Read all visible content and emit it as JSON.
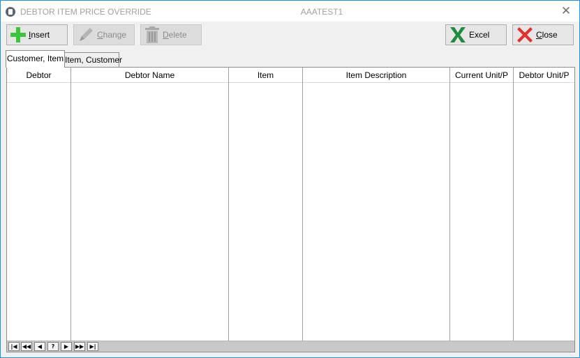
{
  "window": {
    "title": "DEBTOR ITEM PRICE OVERRIDE",
    "subtitle": "AAATEST1",
    "close_glyph": "✕"
  },
  "toolbar": {
    "insert": {
      "prefix": "",
      "accel": "I",
      "rest": "nsert",
      "icon": "plus-icon",
      "color": "#3cc43c"
    },
    "change": {
      "prefix": "",
      "accel": "C",
      "rest": "hange",
      "icon": "pencil-icon"
    },
    "delete": {
      "prefix": "",
      "accel": "D",
      "rest": "elete",
      "icon": "trash-icon"
    },
    "excel": {
      "label": "Excel",
      "icon": "excel-icon",
      "color": "#1e8c3c"
    },
    "close": {
      "prefix": "",
      "accel": "C",
      "rest": "lose",
      "icon": "red-x-icon",
      "color": "#e03030"
    }
  },
  "tabs": [
    {
      "label": "Customer, Item",
      "active": true
    },
    {
      "label": "Item, Customer",
      "active": false
    }
  ],
  "grid": {
    "columns": [
      "Debtor",
      "Debtor Name",
      "Item",
      "Item Description",
      "Current Unit/P",
      "Debtor Unit/P"
    ],
    "rows": []
  },
  "navigator": {
    "buttons": [
      "|◀",
      "◀◀",
      "◀",
      "?",
      "▶",
      "▶▶",
      "▶|"
    ]
  }
}
